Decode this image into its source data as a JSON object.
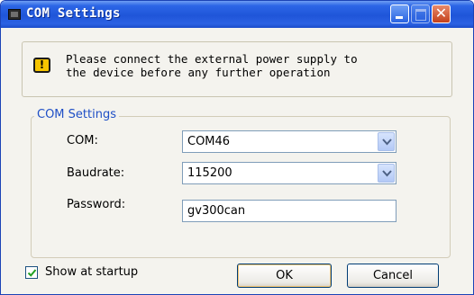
{
  "window": {
    "title": "COM Settings",
    "controls": [
      "minimize",
      "maximize",
      "close"
    ],
    "close_glyph": "✕"
  },
  "notice": {
    "icon": "warning-icon",
    "icon_glyph": "!",
    "text": "Please connect the external power supply to\nthe device before any further operation"
  },
  "group": {
    "legend": "COM Settings",
    "com": {
      "label": "COM:",
      "value": "COM46"
    },
    "baudrate": {
      "label": "Baudrate:",
      "value": "115200"
    },
    "password": {
      "label": "Password:",
      "value": "gv300can"
    }
  },
  "footer": {
    "show_at_startup": {
      "label": "Show at startup",
      "checked": true
    },
    "ok_label": "OK",
    "cancel_label": "Cancel"
  },
  "colors": {
    "titlebar": "#245edb",
    "group_legend": "#1f4fc6",
    "warning": "#f5c400"
  }
}
